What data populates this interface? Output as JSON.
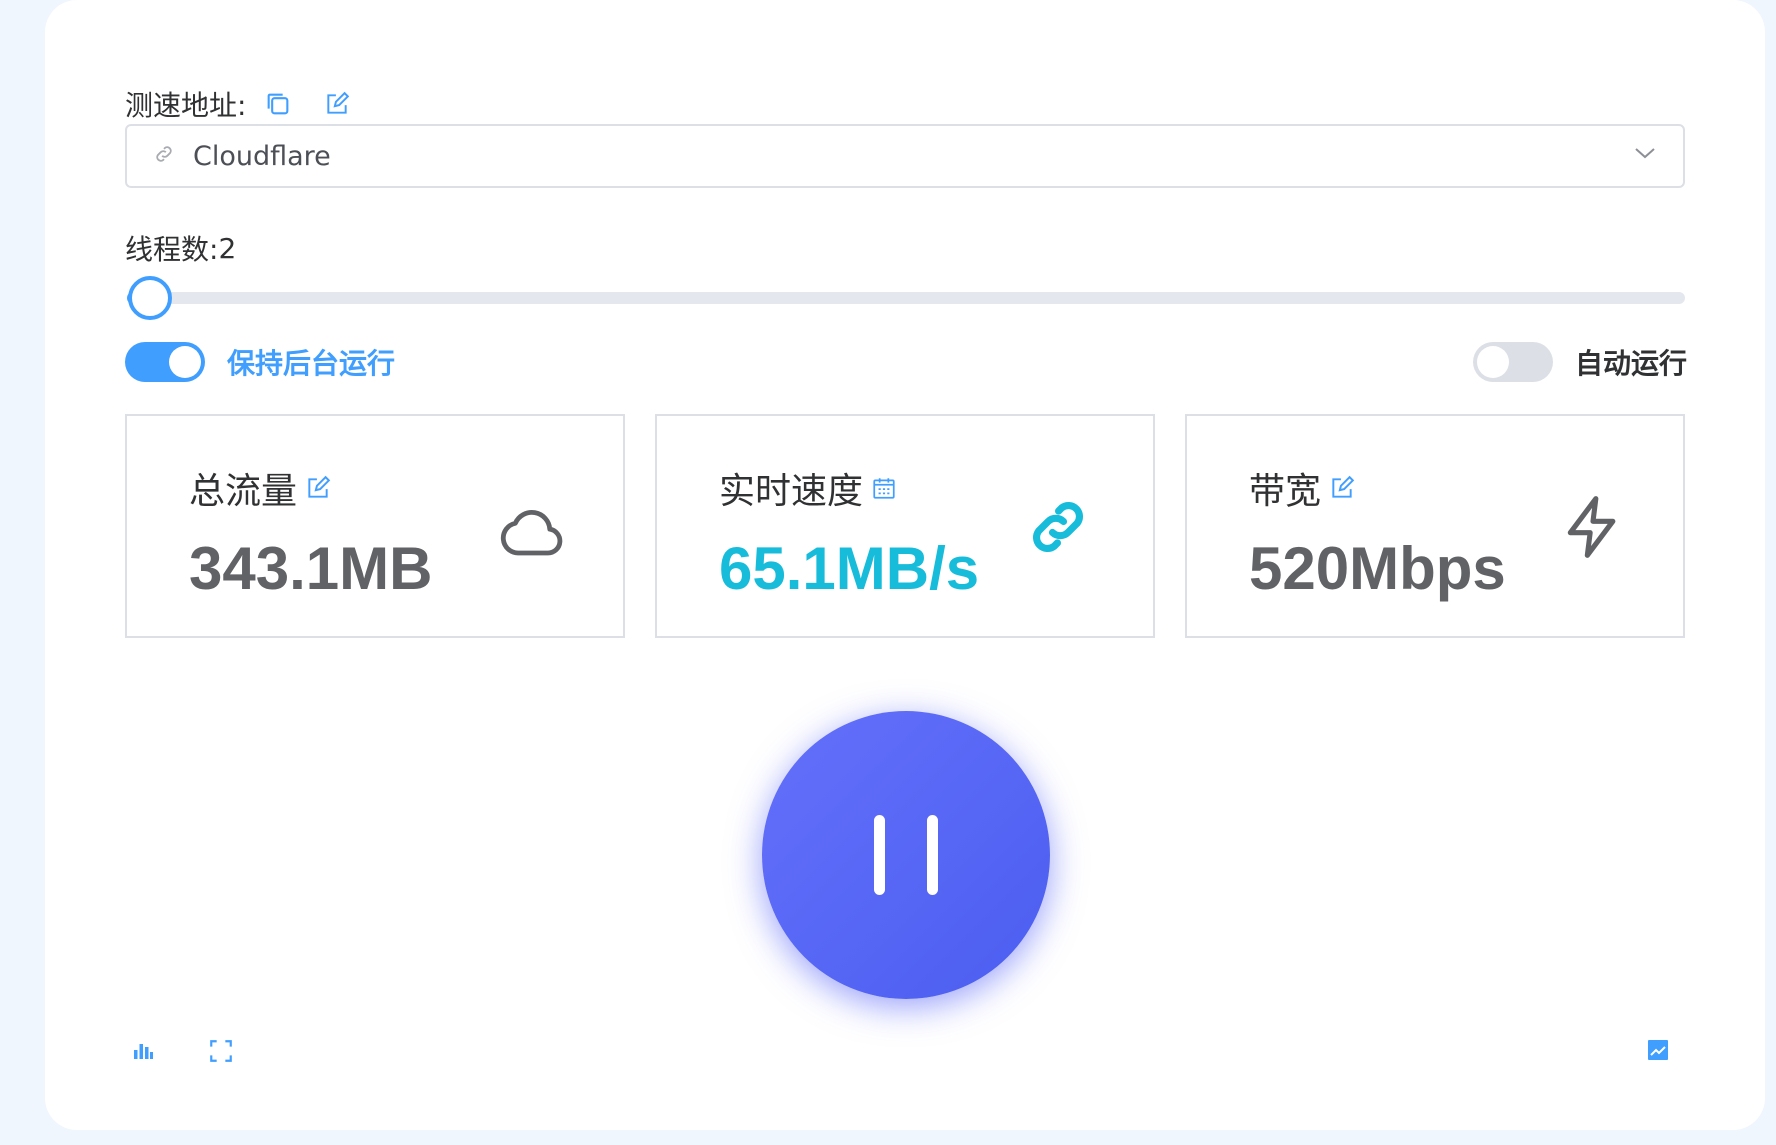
{
  "address": {
    "label": "测速地址:",
    "selected": "Cloudflare"
  },
  "threads": {
    "label": "线程数:",
    "value": "2",
    "slider_fraction": 0.015
  },
  "toggles": {
    "keep_background": {
      "label": "保持后台运行",
      "on": true
    },
    "auto_run": {
      "label": "自动运行",
      "on": false
    }
  },
  "stats": [
    {
      "title": "总流量",
      "value": "343.1MB",
      "title_icon": "edit-icon",
      "icon": "cloud-icon",
      "color": "#606266"
    },
    {
      "title": "实时速度",
      "value": "65.1MB/s",
      "title_icon": "calendar-icon",
      "icon": "link-icon",
      "color": "#18bcdb"
    },
    {
      "title": "带宽",
      "value": "520Mbps",
      "title_icon": "edit-icon",
      "icon": "lightning-icon",
      "color": "#606266"
    }
  ],
  "colors": {
    "accent": "#409eff",
    "speed": "#18bcdb",
    "pause_button": "#5563f5"
  },
  "footer": {
    "left_icons": [
      "bar-chart-icon",
      "fullscreen-icon"
    ],
    "right_icons": [
      "trend-chart-icon"
    ]
  }
}
